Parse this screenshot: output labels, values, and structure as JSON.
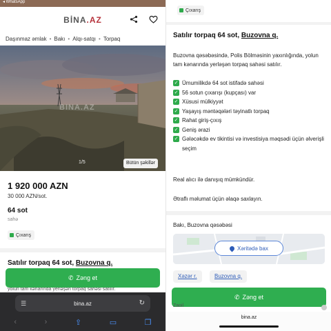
{
  "left": {
    "status_text": "◂ WhatsApp",
    "brand": "BİNA",
    "brand_tld": ".AZ",
    "icons": {
      "share": "share-icon",
      "favorite": "heart-icon"
    },
    "breadcrumb": [
      "Daşınmaz əmlak",
      "Bakı",
      "Alqı-satqı",
      "Torpaq"
    ],
    "photo": {
      "counter": "1/5",
      "all_photos": "Bütün şəkillər",
      "watermark": "BINA.AZ"
    },
    "price": "1 920 000 AZN",
    "price_per": "30 000 AZN/sot.",
    "area": "64 sot",
    "area_unit": "sahə",
    "badge": "Çıxarış",
    "listing_title": "Satılır torpaq 64 sot,",
    "listing_location": "Buzovna q.",
    "cut_text": "yolun tam kənarında yerləşən torpaq sahəsi satılır.",
    "call_button": "Zəng et",
    "browser": {
      "url": "bina.az"
    }
  },
  "right": {
    "badge": "Çıxarış",
    "listing_title": "Satılır torpaq 64 sot,",
    "listing_location": "Buzovna q.",
    "description": "Buzovna qəsəbəsində, Polis Bölməsinin yaxınlığında, yolun tam kənarında yerləşən torpaq sahəsi satılır.",
    "features": [
      "Ümumilikdə 64 sot istifadə sahəsi",
      "56 sotun çıxarışı (kupçası) var",
      "Xüsusi mülkiyyət",
      "Yaşayış məntəqələri təyinatlı torpaq",
      "Rahat giriş-çıxış",
      "Geniş ərazi",
      "Gələcəkdə ev tikintisi və investisiya məqsədi üçün əlverişli seçim"
    ],
    "negotiable": "Real alıcı ilə danışıq mümkündür.",
    "contact_info": "Ətraflı məlumat üçün əlaqə saxlayın.",
    "address": "Bakı, Buzovna qəsəbəsi",
    "map_button": "Xəritədə bax",
    "tags": [
      "Xəzər r.",
      "Buzovna q."
    ],
    "call_button": "Zəng et",
    "peek_text": "Zaoil",
    "url": "bina.az"
  },
  "colors": {
    "accent_green": "#2fae50",
    "brand_red": "#b6323b",
    "link_blue": "#2e5cb8"
  }
}
